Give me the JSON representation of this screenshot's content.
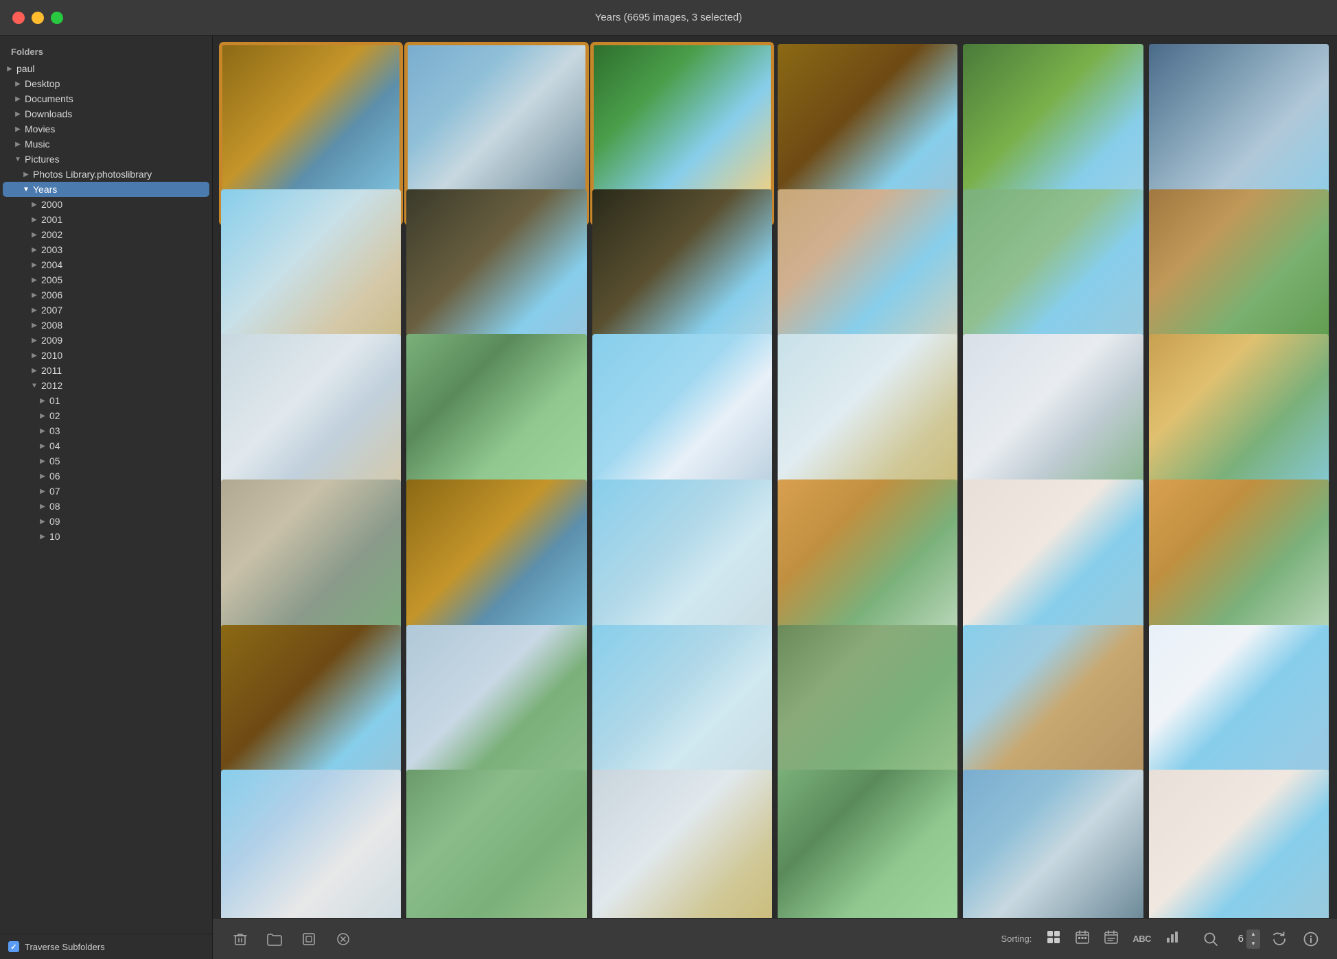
{
  "titlebar": {
    "title": "Years (6695 images, 3 selected)",
    "buttons": {
      "close": "close",
      "minimize": "minimize",
      "maximize": "maximize"
    }
  },
  "sidebar": {
    "header": "Folders",
    "items": [
      {
        "id": "paul",
        "label": "paul",
        "indent": 1,
        "arrow": "collapsed",
        "selected": false
      },
      {
        "id": "desktop",
        "label": "Desktop",
        "indent": 2,
        "arrow": "collapsed",
        "selected": false
      },
      {
        "id": "documents",
        "label": "Documents",
        "indent": 2,
        "arrow": "collapsed",
        "selected": false
      },
      {
        "id": "downloads",
        "label": "Downloads",
        "indent": 2,
        "arrow": "collapsed",
        "selected": false
      },
      {
        "id": "movies",
        "label": "Movies",
        "indent": 2,
        "arrow": "collapsed",
        "selected": false
      },
      {
        "id": "music",
        "label": "Music",
        "indent": 2,
        "arrow": "collapsed",
        "selected": false
      },
      {
        "id": "pictures",
        "label": "Pictures",
        "indent": 2,
        "arrow": "expanded",
        "selected": false
      },
      {
        "id": "photos-library",
        "label": "Photos Library.photoslibrary",
        "indent": 3,
        "arrow": "collapsed",
        "selected": false
      },
      {
        "id": "years",
        "label": "Years",
        "indent": 3,
        "arrow": "expanded",
        "selected": true
      },
      {
        "id": "y2000",
        "label": "2000",
        "indent": 4,
        "arrow": "collapsed",
        "selected": false
      },
      {
        "id": "y2001",
        "label": "2001",
        "indent": 4,
        "arrow": "collapsed",
        "selected": false
      },
      {
        "id": "y2002",
        "label": "2002",
        "indent": 4,
        "arrow": "collapsed",
        "selected": false
      },
      {
        "id": "y2003",
        "label": "2003",
        "indent": 4,
        "arrow": "collapsed",
        "selected": false
      },
      {
        "id": "y2004",
        "label": "2004",
        "indent": 4,
        "arrow": "collapsed",
        "selected": false
      },
      {
        "id": "y2005",
        "label": "2005",
        "indent": 4,
        "arrow": "collapsed",
        "selected": false
      },
      {
        "id": "y2006",
        "label": "2006",
        "indent": 4,
        "arrow": "collapsed",
        "selected": false
      },
      {
        "id": "y2007",
        "label": "2007",
        "indent": 4,
        "arrow": "collapsed",
        "selected": false
      },
      {
        "id": "y2008",
        "label": "2008",
        "indent": 4,
        "arrow": "collapsed",
        "selected": false
      },
      {
        "id": "y2009",
        "label": "2009",
        "indent": 4,
        "arrow": "collapsed",
        "selected": false
      },
      {
        "id": "y2010",
        "label": "2010",
        "indent": 4,
        "arrow": "collapsed",
        "selected": false
      },
      {
        "id": "y2011",
        "label": "2011",
        "indent": 4,
        "arrow": "collapsed",
        "selected": false
      },
      {
        "id": "y2012",
        "label": "2012",
        "indent": 4,
        "arrow": "expanded",
        "selected": false
      },
      {
        "id": "m01",
        "label": "01",
        "indent": 5,
        "arrow": "collapsed",
        "selected": false
      },
      {
        "id": "m02",
        "label": "02",
        "indent": 5,
        "arrow": "collapsed",
        "selected": false
      },
      {
        "id": "m03",
        "label": "03",
        "indent": 5,
        "arrow": "collapsed",
        "selected": false
      },
      {
        "id": "m04",
        "label": "04",
        "indent": 5,
        "arrow": "collapsed",
        "selected": false
      },
      {
        "id": "m05",
        "label": "05",
        "indent": 5,
        "arrow": "collapsed",
        "selected": false
      },
      {
        "id": "m06",
        "label": "06",
        "indent": 5,
        "arrow": "collapsed",
        "selected": false
      },
      {
        "id": "m07",
        "label": "07",
        "indent": 5,
        "arrow": "collapsed",
        "selected": false
      },
      {
        "id": "m08",
        "label": "08",
        "indent": 5,
        "arrow": "collapsed",
        "selected": false
      },
      {
        "id": "m09",
        "label": "09",
        "indent": 5,
        "arrow": "collapsed",
        "selected": false
      },
      {
        "id": "m10",
        "label": "10",
        "indent": 5,
        "arrow": "collapsed",
        "selected": false
      }
    ],
    "traverse_subfolders_label": "Traverse Subfolders",
    "traverse_checked": true
  },
  "toolbar": {
    "sorting_label": "Sorting:",
    "size_value": "6",
    "tools": [
      {
        "id": "delete",
        "icon": "🗑",
        "label": "delete"
      },
      {
        "id": "folder",
        "icon": "📁",
        "label": "folder"
      },
      {
        "id": "preview",
        "icon": "⬜",
        "label": "preview"
      },
      {
        "id": "close",
        "icon": "✕",
        "label": "close"
      }
    ],
    "sort_icons": [
      {
        "id": "grid",
        "icon": "⊞",
        "active": true
      },
      {
        "id": "calendar",
        "icon": "📅",
        "active": false
      },
      {
        "id": "calendar2",
        "icon": "🗓",
        "active": false
      },
      {
        "id": "abc",
        "icon": "ABC",
        "active": false
      },
      {
        "id": "chart",
        "icon": "📊",
        "active": false
      }
    ],
    "action_icons": [
      {
        "id": "search",
        "icon": "🔍",
        "label": "search"
      },
      {
        "id": "refresh",
        "icon": "↻",
        "label": "refresh"
      },
      {
        "id": "info",
        "icon": "ℹ",
        "label": "info"
      }
    ]
  },
  "photos": {
    "grid": [
      {
        "id": 1,
        "selected": true,
        "color_class": "photo-windmill-golden",
        "icon": "🏗"
      },
      {
        "id": 2,
        "selected": true,
        "color_class": "photo-lighthouse-white",
        "icon": "🗼"
      },
      {
        "id": 3,
        "selected": true,
        "color_class": "photo-tower-palm",
        "icon": "🌴"
      },
      {
        "id": 4,
        "selected": false,
        "color_class": "photo-windmill-brown",
        "icon": "⚙"
      },
      {
        "id": 5,
        "selected": false,
        "color_class": "photo-tower-trees",
        "icon": "🏛"
      },
      {
        "id": 6,
        "selected": false,
        "color_class": "photo-windmill-sky",
        "icon": "🌬"
      },
      {
        "id": 7,
        "selected": false,
        "color_class": "photo-lighthouse-beach",
        "icon": "🏠"
      },
      {
        "id": 8,
        "selected": false,
        "color_class": "photo-windmill-dark",
        "icon": "⚙"
      },
      {
        "id": 9,
        "selected": false,
        "color_class": "photo-windmill-dark2",
        "icon": "⚙"
      },
      {
        "id": 10,
        "selected": false,
        "color_class": "photo-church-tower",
        "icon": "⛪"
      },
      {
        "id": 11,
        "selected": false,
        "color_class": "photo-minaret",
        "icon": "🕌"
      },
      {
        "id": 12,
        "selected": false,
        "color_class": "photo-pyramid",
        "icon": "🏛"
      },
      {
        "id": 13,
        "selected": false,
        "color_class": "photo-lighthouse-slim",
        "icon": "🗼"
      },
      {
        "id": 14,
        "selected": false,
        "color_class": "photo-windmill-field",
        "icon": "⚙"
      },
      {
        "id": 15,
        "selected": false,
        "color_class": "photo-church-blue",
        "icon": "⛪"
      },
      {
        "id": 16,
        "selected": false,
        "color_class": "photo-lighthouse-tall",
        "icon": "🗼"
      },
      {
        "id": 17,
        "selected": false,
        "color_class": "photo-building-white",
        "icon": "🏢"
      },
      {
        "id": 18,
        "selected": false,
        "color_class": "photo-tower-ornate",
        "icon": "🏛"
      },
      {
        "id": 19,
        "selected": false,
        "color_class": "photo-row3-6",
        "icon": ""
      },
      {
        "id": 20,
        "selected": false,
        "color_class": "photo-windmill-golden",
        "icon": "⚙"
      },
      {
        "id": 21,
        "selected": false,
        "color_class": "photo-lighthouse-tower",
        "icon": "🗼"
      },
      {
        "id": 22,
        "selected": false,
        "color_class": "photo-pagoda",
        "icon": "🛕"
      },
      {
        "id": 23,
        "selected": false,
        "color_class": "photo-church-arch",
        "icon": "⛪"
      },
      {
        "id": 24,
        "selected": false,
        "color_class": "photo-pagoda",
        "icon": "🛕"
      },
      {
        "id": 25,
        "selected": false,
        "color_class": "photo-windmill-brown",
        "icon": "⚙"
      },
      {
        "id": 26,
        "selected": false,
        "color_class": "photo-castle",
        "icon": "🏰"
      },
      {
        "id": 27,
        "selected": false,
        "color_class": "photo-lighthouse-tower",
        "icon": "🗼"
      },
      {
        "id": 28,
        "selected": false,
        "color_class": "photo-mineshaft",
        "icon": "⚙"
      },
      {
        "id": 29,
        "selected": false,
        "color_class": "photo-dome-brown",
        "icon": "🏛"
      },
      {
        "id": 30,
        "selected": false,
        "color_class": "photo-dome-white",
        "icon": "🏛"
      },
      {
        "id": 31,
        "selected": false,
        "color_class": "photo-church-white",
        "icon": "⛪"
      },
      {
        "id": 32,
        "selected": false,
        "color_class": "photo-lighthouse-red",
        "icon": "🗼"
      },
      {
        "id": 33,
        "selected": false,
        "color_class": "photo-lighthouse-striped",
        "icon": "🗼"
      },
      {
        "id": 34,
        "selected": false,
        "color_class": "photo-windmill-field",
        "icon": "⚙"
      },
      {
        "id": 35,
        "selected": false,
        "color_class": "photo-lighthouse-white",
        "icon": "🏠"
      },
      {
        "id": 36,
        "selected": false,
        "color_class": "photo-church-arch",
        "icon": "⛪"
      }
    ]
  }
}
